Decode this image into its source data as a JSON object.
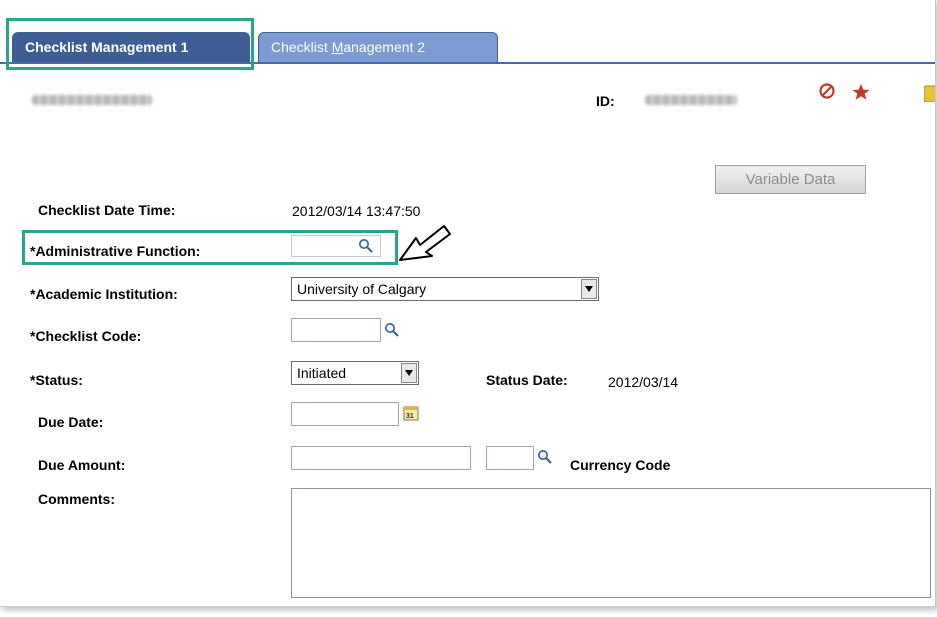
{
  "tabs": [
    {
      "label": "Checklist Management 1",
      "active": true
    },
    {
      "label_pre": "Checklist ",
      "label_u": "M",
      "label_post": "anagement 2",
      "active": false
    }
  ],
  "header": {
    "id_label": "ID:"
  },
  "buttons": {
    "variable_data": "Variable Data"
  },
  "form": {
    "checklist_datetime_label": "Checklist Date Time:",
    "checklist_datetime_value": "2012/03/14 13:47:50",
    "admin_function_label": "*Administrative Function:",
    "academic_institution_label": "*Academic Institution:",
    "academic_institution_value": "University of Calgary",
    "checklist_code_label": "*Checklist Code:",
    "status_label": "*Status:",
    "status_value": "Initiated",
    "status_date_label": "Status Date:",
    "status_date_value": "2012/03/14",
    "due_date_label": "Due Date:",
    "due_amount_label": "Due Amount:",
    "currency_code_label": "Currency Code",
    "comments_label": "Comments:"
  },
  "colors": {
    "tab_active": "#3e5d95",
    "tab_inactive": "#7e9ad2",
    "highlight": "#26a58f",
    "icon_red": "#c0392b"
  }
}
